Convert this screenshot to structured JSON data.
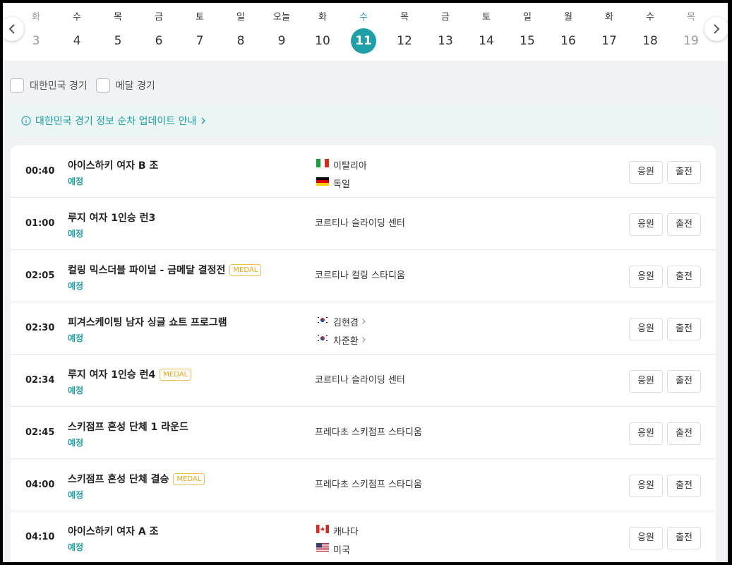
{
  "date_strip": {
    "days": [
      {
        "dow": "화",
        "num": "3"
      },
      {
        "dow": "수",
        "num": "4"
      },
      {
        "dow": "목",
        "num": "5"
      },
      {
        "dow": "금",
        "num": "6"
      },
      {
        "dow": "토",
        "num": "7"
      },
      {
        "dow": "일",
        "num": "8"
      },
      {
        "dow": "오늘",
        "num": "9"
      },
      {
        "dow": "화",
        "num": "10"
      },
      {
        "dow": "수",
        "num": "11",
        "selected": true
      },
      {
        "dow": "목",
        "num": "12"
      },
      {
        "dow": "금",
        "num": "13"
      },
      {
        "dow": "토",
        "num": "14"
      },
      {
        "dow": "일",
        "num": "15"
      },
      {
        "dow": "월",
        "num": "16"
      },
      {
        "dow": "화",
        "num": "17"
      },
      {
        "dow": "수",
        "num": "18"
      },
      {
        "dow": "목",
        "num": "19"
      }
    ]
  },
  "filters": {
    "korea": "대한민국 경기",
    "medal": "메달 경기"
  },
  "notice": {
    "text": "대한민국 경기 정보 순차 업데이트 안내"
  },
  "colors": {
    "accent": "#1fa0a8",
    "medal": "#e6a817"
  },
  "buttons": {
    "cheer": "응원",
    "substitute": "출전"
  },
  "events": [
    {
      "time": "00:40",
      "title": "아이스하키 여자 B 조",
      "status": "예정",
      "medal": "",
      "venue": "",
      "teams": [
        {
          "flag": "italy-flag-icon",
          "name": "이탈리아"
        },
        {
          "flag": "germany-flag-icon",
          "name": "독일"
        }
      ]
    },
    {
      "time": "01:00",
      "title": "루지 여자 1인승 런3",
      "status": "예정",
      "medal": "",
      "venue": "코르티나 슬라이딩 센터",
      "teams": []
    },
    {
      "time": "02:05",
      "title": "컬링 믹스더블 파이널 - 금메달 결정전",
      "status": "예정",
      "medal": "MEDAL",
      "venue": "코르티나 컬링 스타디움",
      "teams": []
    },
    {
      "time": "02:30",
      "title": "피겨스케이팅 남자 싱글 쇼트 프로그램",
      "status": "예정",
      "medal": "",
      "venue": "",
      "teams": [
        {
          "flag": "korea-flag-icon",
          "name": "김현겸",
          "link": true
        },
        {
          "flag": "korea-flag-icon",
          "name": "차준환",
          "link": true
        }
      ]
    },
    {
      "time": "02:34",
      "title": "루지 여자 1인승 런4",
      "status": "예정",
      "medal": "MEDAL",
      "venue": "코르티나 슬라이딩 센터",
      "teams": []
    },
    {
      "time": "02:45",
      "title": "스키점프 혼성 단체 1 라운드",
      "status": "예정",
      "medal": "",
      "venue": "프레다초 스키점프 스타디움",
      "teams": []
    },
    {
      "time": "04:00",
      "title": "스키점프 혼성 단체 결승",
      "status": "예정",
      "medal": "MEDAL",
      "venue": "프레다초 스키점프 스타디움",
      "teams": []
    },
    {
      "time": "04:10",
      "title": "아이스하키 여자 A 조",
      "status": "예정",
      "medal": "",
      "venue": "",
      "teams": [
        {
          "flag": "canada-flag-icon",
          "name": "캐나다"
        },
        {
          "flag": "usa-flag-icon",
          "name": "미국"
        }
      ]
    }
  ]
}
